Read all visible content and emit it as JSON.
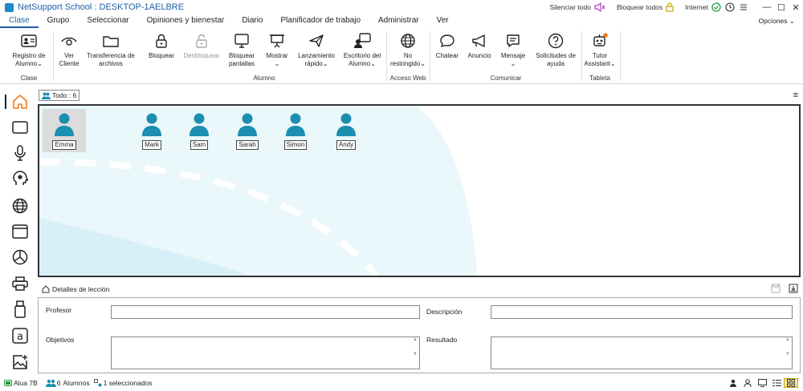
{
  "window": {
    "title": "NetSupport School : DESKTOP-1AELBRE",
    "silence_all": "Silenciar todo",
    "lock_all": "Bloquear todos",
    "internet": "Internet"
  },
  "menu": {
    "items": [
      "Clase",
      "Grupo",
      "Seleccionar",
      "Opiniones y bienestar",
      "Diario",
      "Planificador de trabajo",
      "Administrar",
      "Ver"
    ],
    "options": "Opciones"
  },
  "ribbon": {
    "buttons": {
      "registro_l1": "Registro de",
      "registro_l2": "Alumno",
      "ver_l1": "Ver",
      "ver_l2": "Cliente",
      "transfer_l1": "Transferencia de",
      "transfer_l2": "archivos",
      "bloquear": "Bloquear",
      "desbloquear": "Desbloquear",
      "bpantallas_l1": "Bloquear",
      "bpantallas_l2": "pantallas",
      "mostrar": "Mostrar",
      "lanz_l1": "Lanzamiento",
      "lanz_l2": "rápido",
      "escritorio_l1": "Escritorio del",
      "escritorio_l2": "Alumno",
      "norestr_l1": "No",
      "norestr_l2": "restringido",
      "chatear": "Chatear",
      "anuncio": "Anuncio",
      "mensaje": "Mensaje",
      "solic_l1": "Solicitudes de",
      "solic_l2": "ayuda",
      "tutor_l1": "Tutor",
      "tutor_l2": "Assistant"
    },
    "groups": {
      "clase": "Clase",
      "alumno": "Alumno",
      "acceso_web": "Acceso Web",
      "comunicar": "Comunicar",
      "tableta": "Tableta"
    }
  },
  "tabs": {
    "todo": "Todo : 6"
  },
  "students": [
    {
      "name": "Emma"
    },
    {
      "name": "Mark"
    },
    {
      "name": "Sam"
    },
    {
      "name": "Sarah"
    },
    {
      "name": "Simon"
    },
    {
      "name": "Andy"
    }
  ],
  "lesson": {
    "title": "Detalles de lección",
    "profesor": "Profesor",
    "descripcion": "Descripción",
    "objetivos": "Objetivos",
    "resultado": "Resultado"
  },
  "status": {
    "room": "Alua 7B",
    "count": "6",
    "alumnos": "Alumnos",
    "selected": "1 seleccionados"
  },
  "colors": {
    "accent": "#1f5fa6",
    "student": "#1a8fb0",
    "selection": "#dcdcdc"
  }
}
